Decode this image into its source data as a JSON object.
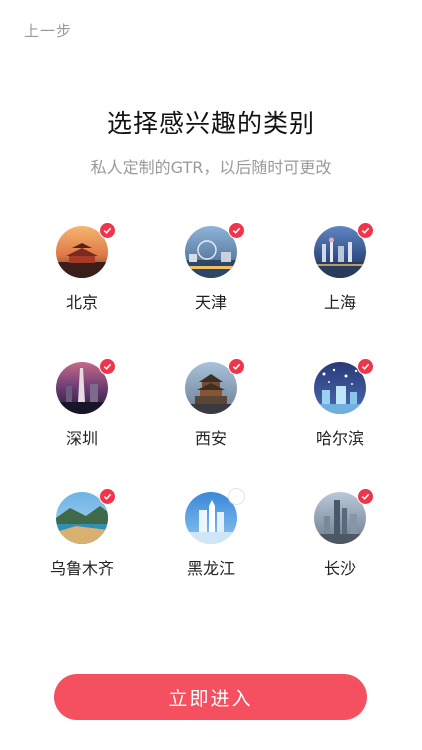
{
  "nav": {
    "back_label": "上一步"
  },
  "header": {
    "title": "选择感兴趣的类别",
    "subtitle": "私人定制的GTR，以后随时可更改"
  },
  "cities": [
    {
      "name": "北京",
      "selected": true,
      "theme": "palace-sunset"
    },
    {
      "name": "天津",
      "selected": true,
      "theme": "river-wheel"
    },
    {
      "name": "上海",
      "selected": true,
      "theme": "skyline-dusk"
    },
    {
      "name": "深圳",
      "selected": true,
      "theme": "tower-night"
    },
    {
      "name": "西安",
      "selected": true,
      "theme": "bell-tower"
    },
    {
      "name": "哈尔滨",
      "selected": true,
      "theme": "ice-lights"
    },
    {
      "name": "乌鲁木齐",
      "selected": true,
      "theme": "lake-mountain"
    },
    {
      "name": "黑龙江",
      "selected": false,
      "theme": "ice-sculpture"
    },
    {
      "name": "长沙",
      "selected": true,
      "theme": "city-towers"
    }
  ],
  "footer": {
    "enter_label": "立即进入"
  },
  "colors": {
    "accent": "#f4505f",
    "check": "#f0354b",
    "muted_text": "#9a9a9a"
  }
}
